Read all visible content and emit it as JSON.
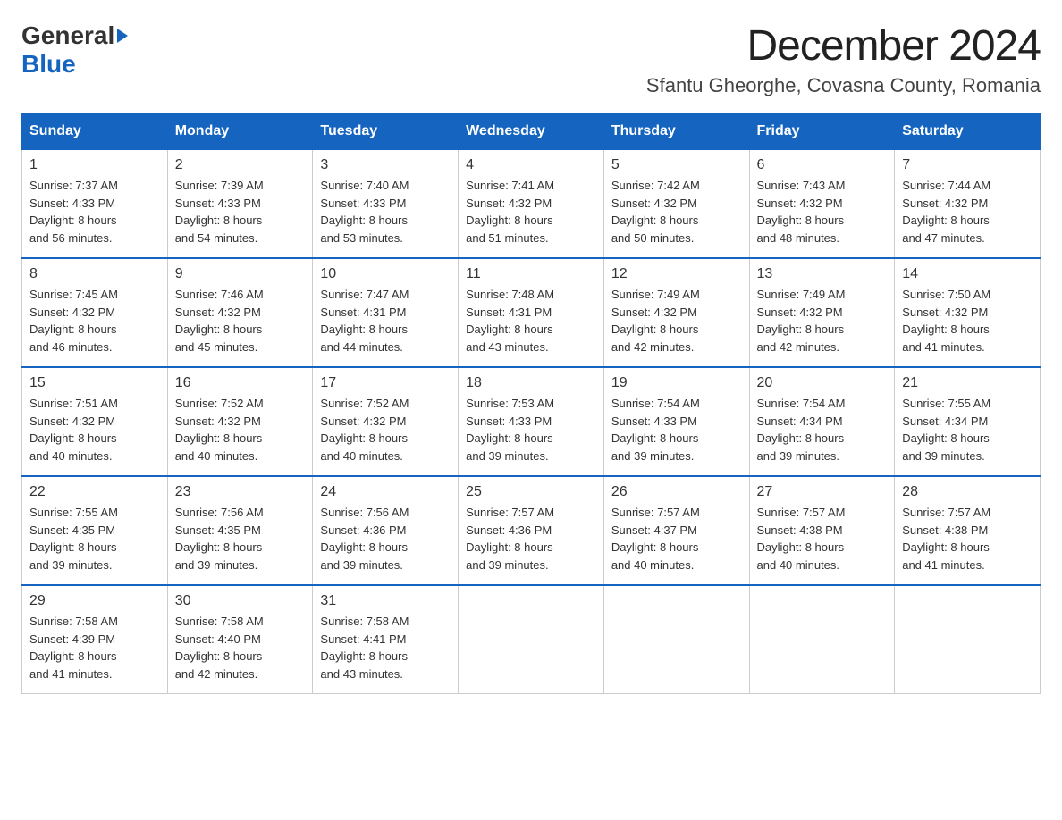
{
  "header": {
    "logo_general": "General",
    "logo_blue": "Blue",
    "title": "December 2024",
    "subtitle": "Sfantu Gheorghe, Covasna County, Romania"
  },
  "days_of_week": [
    "Sunday",
    "Monday",
    "Tuesday",
    "Wednesday",
    "Thursday",
    "Friday",
    "Saturday"
  ],
  "weeks": [
    [
      {
        "day": "1",
        "sunrise": "7:37 AM",
        "sunset": "4:33 PM",
        "daylight": "8 hours and 56 minutes."
      },
      {
        "day": "2",
        "sunrise": "7:39 AM",
        "sunset": "4:33 PM",
        "daylight": "8 hours and 54 minutes."
      },
      {
        "day": "3",
        "sunrise": "7:40 AM",
        "sunset": "4:33 PM",
        "daylight": "8 hours and 53 minutes."
      },
      {
        "day": "4",
        "sunrise": "7:41 AM",
        "sunset": "4:32 PM",
        "daylight": "8 hours and 51 minutes."
      },
      {
        "day": "5",
        "sunrise": "7:42 AM",
        "sunset": "4:32 PM",
        "daylight": "8 hours and 50 minutes."
      },
      {
        "day": "6",
        "sunrise": "7:43 AM",
        "sunset": "4:32 PM",
        "daylight": "8 hours and 48 minutes."
      },
      {
        "day": "7",
        "sunrise": "7:44 AM",
        "sunset": "4:32 PM",
        "daylight": "8 hours and 47 minutes."
      }
    ],
    [
      {
        "day": "8",
        "sunrise": "7:45 AM",
        "sunset": "4:32 PM",
        "daylight": "8 hours and 46 minutes."
      },
      {
        "day": "9",
        "sunrise": "7:46 AM",
        "sunset": "4:32 PM",
        "daylight": "8 hours and 45 minutes."
      },
      {
        "day": "10",
        "sunrise": "7:47 AM",
        "sunset": "4:31 PM",
        "daylight": "8 hours and 44 minutes."
      },
      {
        "day": "11",
        "sunrise": "7:48 AM",
        "sunset": "4:31 PM",
        "daylight": "8 hours and 43 minutes."
      },
      {
        "day": "12",
        "sunrise": "7:49 AM",
        "sunset": "4:32 PM",
        "daylight": "8 hours and 42 minutes."
      },
      {
        "day": "13",
        "sunrise": "7:49 AM",
        "sunset": "4:32 PM",
        "daylight": "8 hours and 42 minutes."
      },
      {
        "day": "14",
        "sunrise": "7:50 AM",
        "sunset": "4:32 PM",
        "daylight": "8 hours and 41 minutes."
      }
    ],
    [
      {
        "day": "15",
        "sunrise": "7:51 AM",
        "sunset": "4:32 PM",
        "daylight": "8 hours and 40 minutes."
      },
      {
        "day": "16",
        "sunrise": "7:52 AM",
        "sunset": "4:32 PM",
        "daylight": "8 hours and 40 minutes."
      },
      {
        "day": "17",
        "sunrise": "7:52 AM",
        "sunset": "4:32 PM",
        "daylight": "8 hours and 40 minutes."
      },
      {
        "day": "18",
        "sunrise": "7:53 AM",
        "sunset": "4:33 PM",
        "daylight": "8 hours and 39 minutes."
      },
      {
        "day": "19",
        "sunrise": "7:54 AM",
        "sunset": "4:33 PM",
        "daylight": "8 hours and 39 minutes."
      },
      {
        "day": "20",
        "sunrise": "7:54 AM",
        "sunset": "4:34 PM",
        "daylight": "8 hours and 39 minutes."
      },
      {
        "day": "21",
        "sunrise": "7:55 AM",
        "sunset": "4:34 PM",
        "daylight": "8 hours and 39 minutes."
      }
    ],
    [
      {
        "day": "22",
        "sunrise": "7:55 AM",
        "sunset": "4:35 PM",
        "daylight": "8 hours and 39 minutes."
      },
      {
        "day": "23",
        "sunrise": "7:56 AM",
        "sunset": "4:35 PM",
        "daylight": "8 hours and 39 minutes."
      },
      {
        "day": "24",
        "sunrise": "7:56 AM",
        "sunset": "4:36 PM",
        "daylight": "8 hours and 39 minutes."
      },
      {
        "day": "25",
        "sunrise": "7:57 AM",
        "sunset": "4:36 PM",
        "daylight": "8 hours and 39 minutes."
      },
      {
        "day": "26",
        "sunrise": "7:57 AM",
        "sunset": "4:37 PM",
        "daylight": "8 hours and 40 minutes."
      },
      {
        "day": "27",
        "sunrise": "7:57 AM",
        "sunset": "4:38 PM",
        "daylight": "8 hours and 40 minutes."
      },
      {
        "day": "28",
        "sunrise": "7:57 AM",
        "sunset": "4:38 PM",
        "daylight": "8 hours and 41 minutes."
      }
    ],
    [
      {
        "day": "29",
        "sunrise": "7:58 AM",
        "sunset": "4:39 PM",
        "daylight": "8 hours and 41 minutes."
      },
      {
        "day": "30",
        "sunrise": "7:58 AM",
        "sunset": "4:40 PM",
        "daylight": "8 hours and 42 minutes."
      },
      {
        "day": "31",
        "sunrise": "7:58 AM",
        "sunset": "4:41 PM",
        "daylight": "8 hours and 43 minutes."
      },
      null,
      null,
      null,
      null
    ]
  ],
  "labels": {
    "sunrise": "Sunrise:",
    "sunset": "Sunset:",
    "daylight": "Daylight:"
  }
}
